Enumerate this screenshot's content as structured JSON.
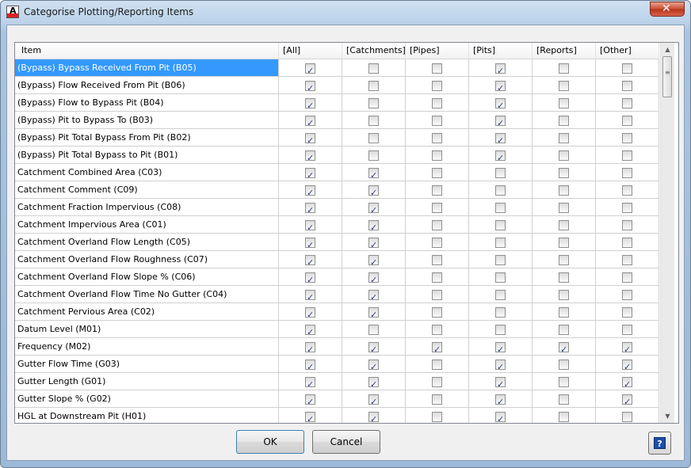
{
  "window": {
    "title": "Categorise Plotting/Reporting Items"
  },
  "app_icon_letter": "A",
  "columns": [
    "Item",
    "[All]",
    "[Catchments]",
    "[Pipes]",
    "[Pits]",
    "[Reports]",
    "[Other]"
  ],
  "rows": [
    {
      "item": "(Bypass) Bypass Received From Pit (B05)",
      "selected": true,
      "checks": [
        1,
        0,
        0,
        1,
        0,
        0
      ]
    },
    {
      "item": "(Bypass) Flow Received From Pit (B06)",
      "selected": false,
      "checks": [
        1,
        0,
        0,
        1,
        0,
        0
      ]
    },
    {
      "item": "(Bypass) Flow to Bypass Pit (B04)",
      "selected": false,
      "checks": [
        1,
        0,
        0,
        1,
        0,
        0
      ]
    },
    {
      "item": "(Bypass) Pit to Bypass To (B03)",
      "selected": false,
      "checks": [
        1,
        0,
        0,
        1,
        0,
        0
      ]
    },
    {
      "item": "(Bypass) Pit Total Bypass From Pit (B02)",
      "selected": false,
      "checks": [
        1,
        0,
        0,
        1,
        0,
        0
      ]
    },
    {
      "item": "(Bypass) Pit Total Bypass to Pit (B01)",
      "selected": false,
      "checks": [
        1,
        0,
        0,
        1,
        0,
        0
      ]
    },
    {
      "item": "Catchment Combined Area (C03)",
      "selected": false,
      "checks": [
        1,
        1,
        0,
        0,
        0,
        0
      ]
    },
    {
      "item": "Catchment Comment (C09)",
      "selected": false,
      "checks": [
        1,
        1,
        0,
        0,
        0,
        0
      ]
    },
    {
      "item": "Catchment Fraction Impervious (C08)",
      "selected": false,
      "checks": [
        1,
        1,
        0,
        0,
        0,
        0
      ]
    },
    {
      "item": "Catchment Impervious Area (C01)",
      "selected": false,
      "checks": [
        1,
        1,
        0,
        0,
        0,
        0
      ]
    },
    {
      "item": "Catchment Overland Flow Length (C05)",
      "selected": false,
      "checks": [
        1,
        1,
        0,
        0,
        0,
        0
      ]
    },
    {
      "item": "Catchment Overland Flow Roughness (C07)",
      "selected": false,
      "checks": [
        1,
        1,
        0,
        0,
        0,
        0
      ]
    },
    {
      "item": "Catchment Overland Flow Slope % (C06)",
      "selected": false,
      "checks": [
        1,
        1,
        0,
        0,
        0,
        0
      ]
    },
    {
      "item": "Catchment Overland Flow Time No Gutter (C04)",
      "selected": false,
      "checks": [
        1,
        1,
        0,
        0,
        0,
        0
      ]
    },
    {
      "item": "Catchment Pervious Area (C02)",
      "selected": false,
      "checks": [
        1,
        1,
        0,
        0,
        0,
        0
      ]
    },
    {
      "item": "Datum Level (M01)",
      "selected": false,
      "checks": [
        1,
        0,
        0,
        0,
        0,
        0
      ]
    },
    {
      "item": "Frequency (M02)",
      "selected": false,
      "checks": [
        1,
        1,
        1,
        1,
        1,
        1
      ]
    },
    {
      "item": "Gutter Flow Time (G03)",
      "selected": false,
      "checks": [
        1,
        1,
        0,
        1,
        0,
        1
      ]
    },
    {
      "item": "Gutter Length (G01)",
      "selected": false,
      "checks": [
        1,
        1,
        0,
        1,
        0,
        1
      ]
    },
    {
      "item": "Gutter Slope % (G02)",
      "selected": false,
      "checks": [
        1,
        1,
        0,
        1,
        0,
        1
      ]
    },
    {
      "item": "HGL at Downstream Pit (H01)",
      "selected": false,
      "checks": [
        1,
        1,
        0,
        1,
        0,
        0
      ]
    }
  ],
  "buttons": {
    "ok": "OK",
    "cancel": "Cancel",
    "help": "?"
  },
  "close_glyph": "✕",
  "scroll": {
    "up": "▲",
    "down": "▼"
  },
  "colors": {
    "selection": "#3399ff"
  }
}
